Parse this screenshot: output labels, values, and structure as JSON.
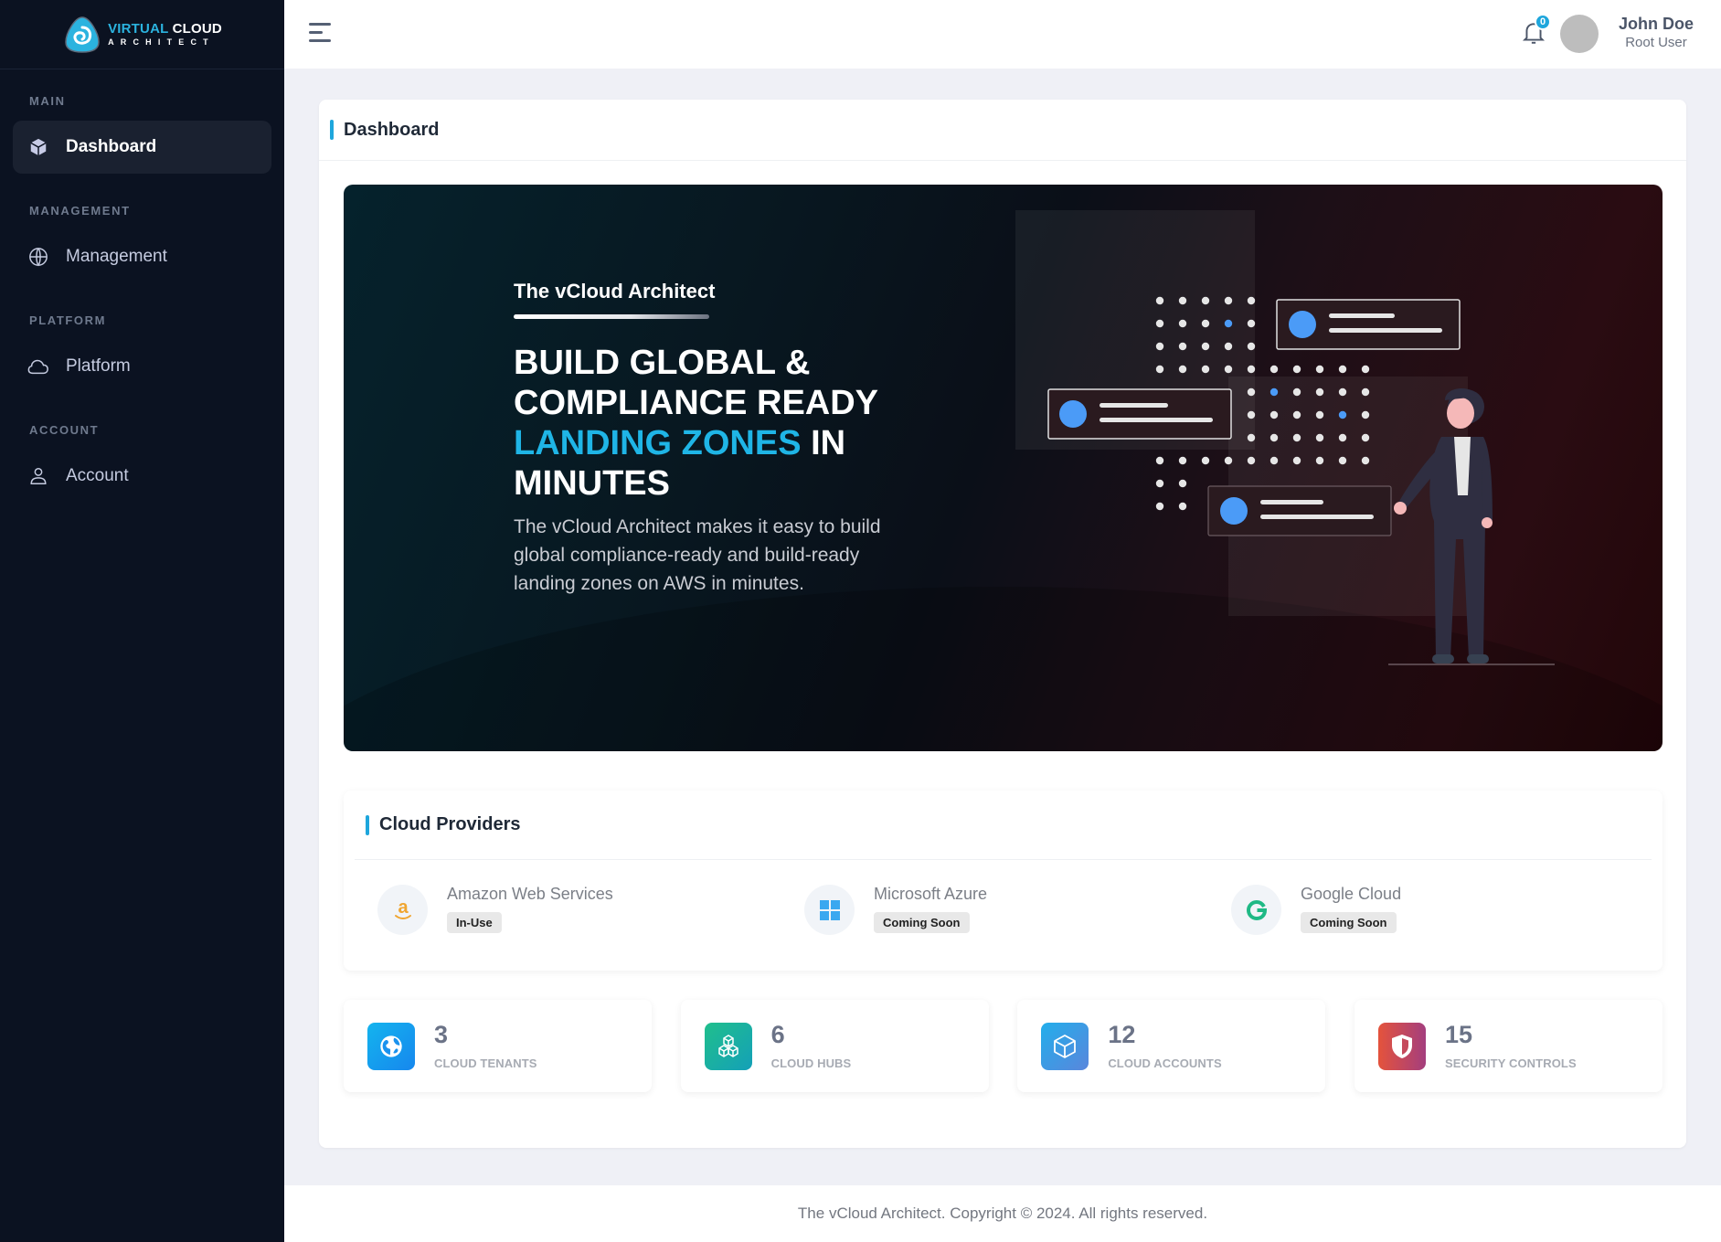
{
  "brand": {
    "name_accent": "VIRTUAL",
    "name_rest": "CLOUD",
    "tagline": "ARCHITECT"
  },
  "sidebar": {
    "sections": [
      {
        "title": "MAIN",
        "item": {
          "label": "Dashboard",
          "icon": "cube-icon",
          "active": true
        }
      },
      {
        "title": "MANAGEMENT",
        "item": {
          "label": "Management",
          "icon": "globe-icon",
          "active": false
        }
      },
      {
        "title": "PLATFORM",
        "item": {
          "label": "Platform",
          "icon": "cloud-icon",
          "active": false
        }
      },
      {
        "title": "ACCOUNT",
        "item": {
          "label": "Account",
          "icon": "user-icon",
          "active": false
        }
      }
    ]
  },
  "header": {
    "notifications_count": "0",
    "user": {
      "name": "John Doe",
      "role": "Root User"
    }
  },
  "page": {
    "title": "Dashboard"
  },
  "hero": {
    "kicker": "The vCloud Architect",
    "title_line1": "BUILD GLOBAL &",
    "title_line2": "COMPLIANCE READY",
    "title_highlight": "LANDING ZONES",
    "title_after_highlight": " IN",
    "title_line4": "MINUTES",
    "description": "The vCloud Architect makes it easy to build global compliance-ready and build-ready landing zones on AWS in minutes."
  },
  "providers": {
    "title": "Cloud Providers",
    "items": [
      {
        "name": "Amazon Web Services",
        "status": "In-Use",
        "icon": "amazon-icon",
        "color": "#f0a530"
      },
      {
        "name": "Microsoft Azure",
        "status": "Coming Soon",
        "icon": "windows-icon",
        "color": "#3aa8f0"
      },
      {
        "name": "Google Cloud",
        "status": "Coming Soon",
        "icon": "google-icon",
        "color": "#1fb985"
      }
    ]
  },
  "stats": [
    {
      "value": "3",
      "label": "CLOUD TENANTS",
      "icon": "globe-icon"
    },
    {
      "value": "6",
      "label": "CLOUD HUBS",
      "icon": "cubes-icon"
    },
    {
      "value": "12",
      "label": "CLOUD ACCOUNTS",
      "icon": "box-icon"
    },
    {
      "value": "15",
      "label": "SECURITY CONTROLS",
      "icon": "shield-icon"
    }
  ],
  "colors": {
    "accent": "#1ea6dc",
    "sidebar_bg": "#0b1221",
    "page_bg": "#eff0f6"
  },
  "footer": {
    "text": "The vCloud Architect. Copyright © 2024. All rights reserved."
  }
}
